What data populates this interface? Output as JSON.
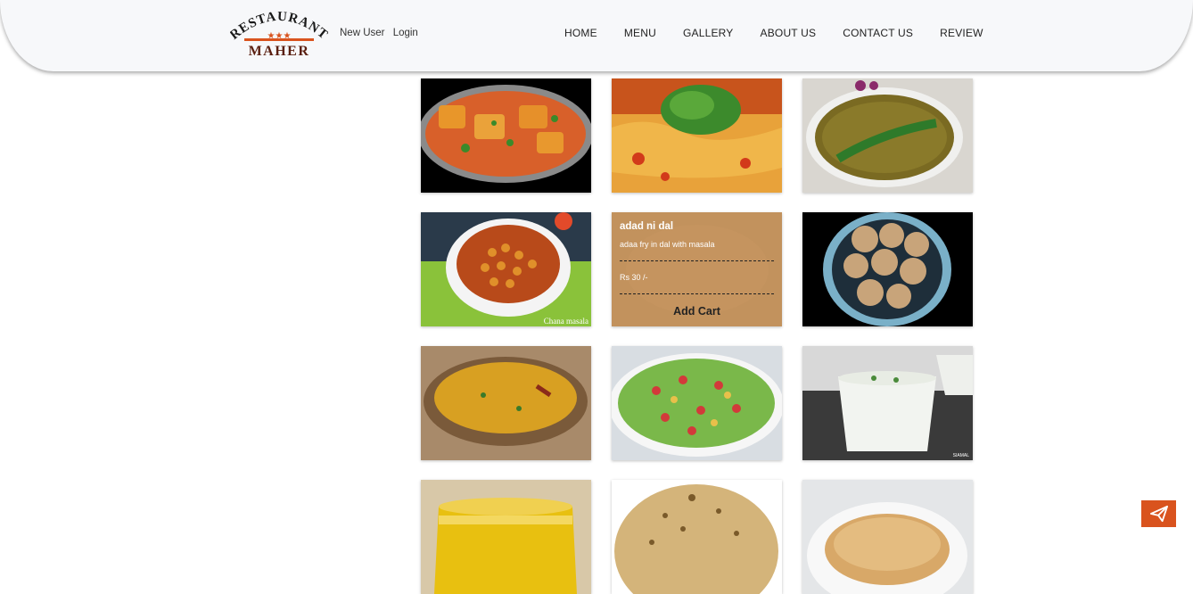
{
  "brand": {
    "logo_top": "RESTAURANT",
    "logo_bottom": "MAHER",
    "stars": "★★★"
  },
  "auth": {
    "new_user": "New User",
    "login": "Login"
  },
  "nav": [
    "HOME",
    "MENU",
    "GALLERY",
    "ABOUT US",
    "CONTACT US",
    "REVIEW"
  ],
  "menu_items": [
    {
      "icon": "paneer-curry-photo"
    },
    {
      "icon": "sev-usal-photo"
    },
    {
      "icon": "moong-curry-photo"
    },
    {
      "icon": "chana-masala-photo",
      "caption": "Chana masala"
    },
    {
      "icon": "dal-photo",
      "hover": true,
      "title": "adad ni dal",
      "description": "adaa fry in dal with masala",
      "price": "Rs 30 /-",
      "add_label": "Add Cart"
    },
    {
      "icon": "dal-baati-photo"
    },
    {
      "icon": "dal-tadka-photo"
    },
    {
      "icon": "salad-photo"
    },
    {
      "icon": "chaas-photo",
      "watermark": "SIAMAL"
    },
    {
      "icon": "ghee-photo"
    },
    {
      "icon": "papad-photo"
    },
    {
      "icon": "roti-photo"
    }
  ],
  "colors": {
    "accent": "#d9531e",
    "overlay": "#c49460",
    "header_bg": "#f7f8fa"
  }
}
